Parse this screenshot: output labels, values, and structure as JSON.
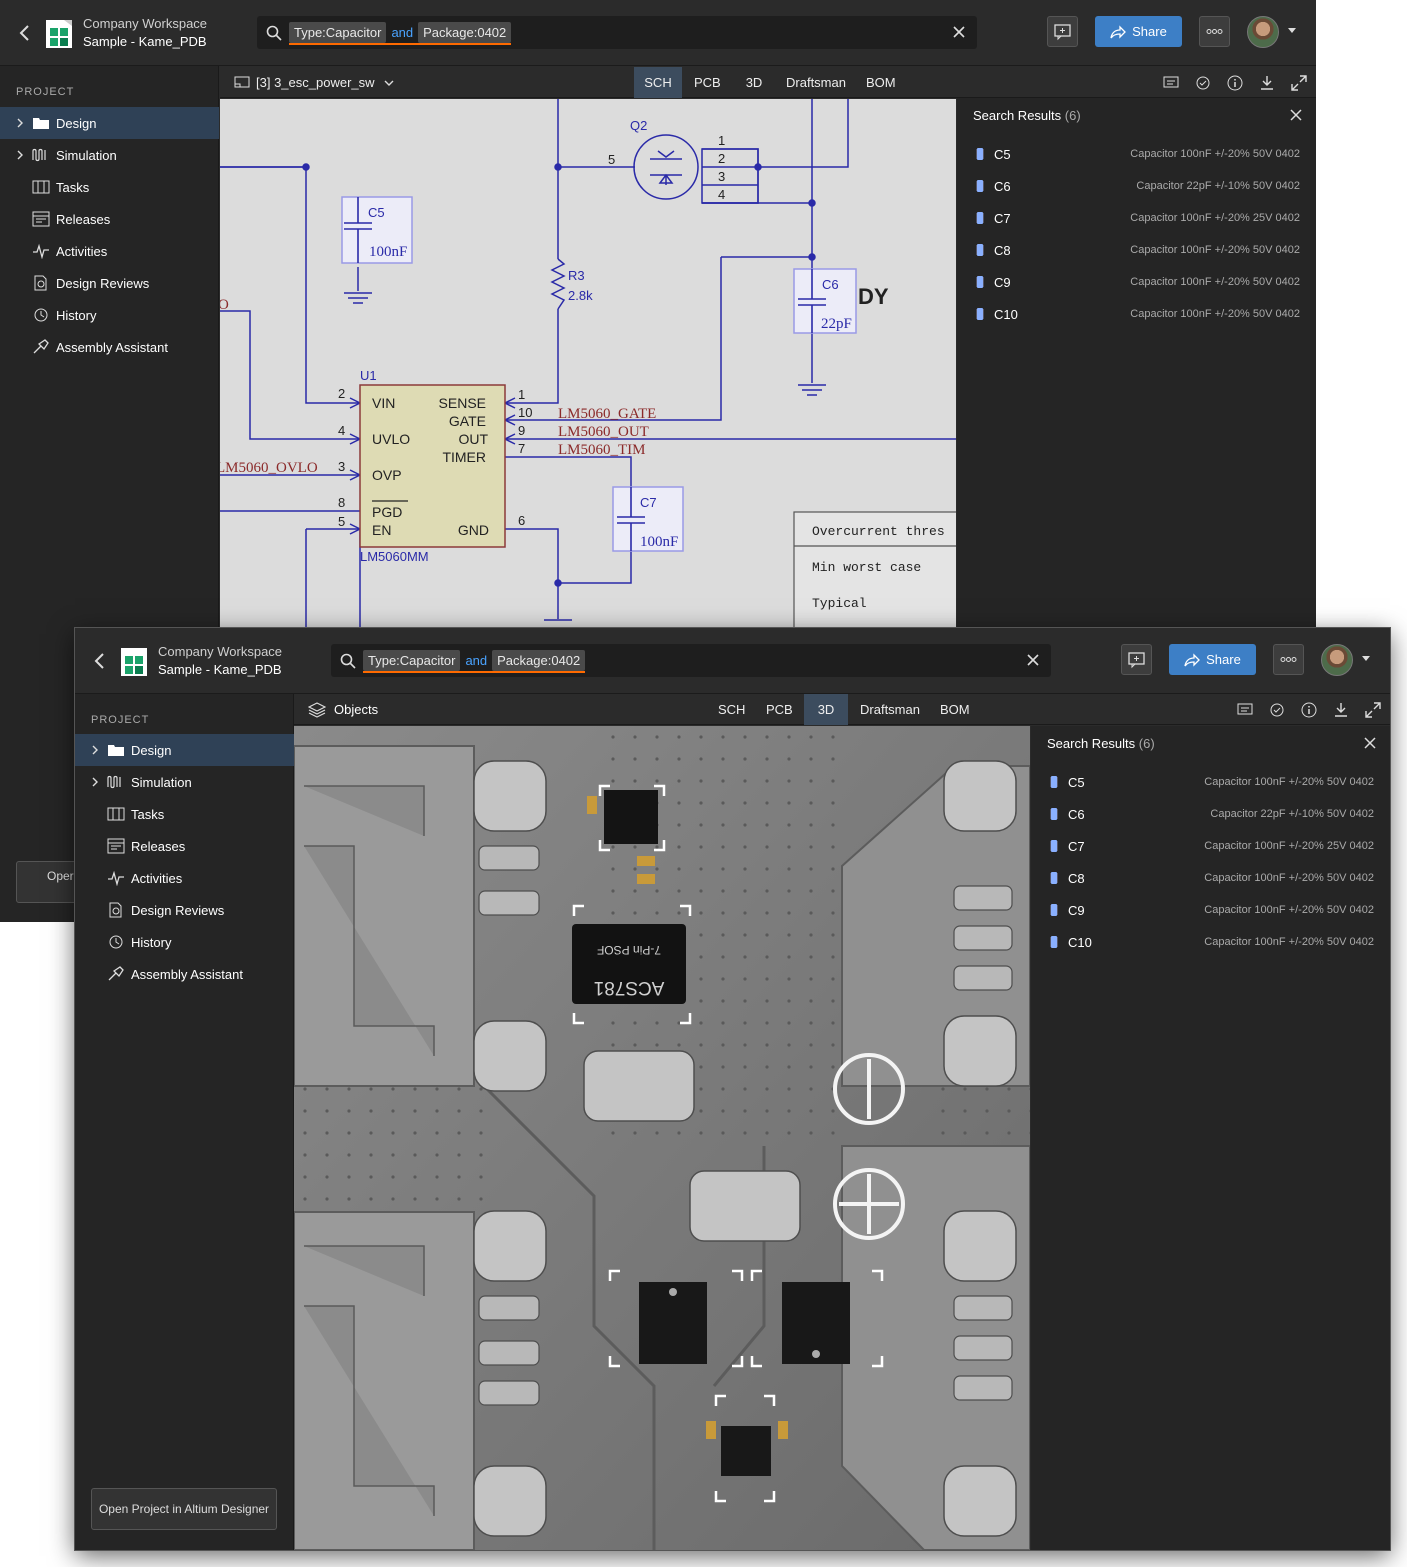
{
  "workspace": {
    "name": "Company Workspace",
    "project": "Sample - Kame_PDB"
  },
  "search": {
    "chip1": "Type:Capacitor",
    "joiner": "and",
    "chip2": "Package:0402"
  },
  "share_label": "Share",
  "sidebar": {
    "heading": "PROJECT",
    "items": [
      "Design",
      "Simulation",
      "Tasks",
      "Releases",
      "Activities",
      "Design Reviews",
      "History",
      "Assembly Assistant"
    ],
    "open_button": "Open Project in Altium Designer",
    "open_button_partial": "Oper"
  },
  "tabs": [
    "SCH",
    "PCB",
    "3D",
    "Draftsman",
    "BOM"
  ],
  "document": "[3] 3_esc_power_sw",
  "objects_label": "Objects",
  "results": {
    "title": "Search Results",
    "count": "(6)",
    "items": [
      {
        "designator": "C5",
        "description": "Capacitor 100nF +/-20% 50V 0402"
      },
      {
        "designator": "C6",
        "description": "Capacitor 22pF +/-10% 50V 0402"
      },
      {
        "designator": "C7",
        "description": "Capacitor 100nF +/-20% 25V 0402"
      },
      {
        "designator": "C8",
        "description": "Capacitor 100nF +/-20% 50V 0402"
      },
      {
        "designator": "C9",
        "description": "Capacitor 100nF +/-20% 50V 0402"
      },
      {
        "designator": "C10",
        "description": "Capacitor 100nF +/-20% 50V 0402"
      }
    ]
  },
  "schematic": {
    "q2": "Q2",
    "q2_pins": [
      "1",
      "2",
      "3",
      "4",
      "5"
    ],
    "c5": {
      "ref": "C5",
      "val": "100nF"
    },
    "c6": {
      "ref": "C6",
      "val": "22pF"
    },
    "c7": {
      "ref": "C7",
      "val": "100nF"
    },
    "r3": {
      "ref": "R3",
      "val": "2.8k"
    },
    "u1": {
      "ref": "U1",
      "part": "LM5060MM",
      "left_pins": [
        "VIN",
        "UVLO",
        "OVP",
        "PGD",
        "EN"
      ],
      "right_pins": [
        "SENSE",
        "GATE",
        "OUT",
        "TIMER",
        "GND"
      ],
      "left_nums": [
        "2",
        "4",
        "3",
        "8",
        "5"
      ],
      "right_nums": [
        "1",
        "10",
        "9",
        "7",
        "6"
      ]
    },
    "nets": [
      "LM5060_GATE",
      "LM5060_OUT",
      "LM5060_TIM",
      "LM5060_OVLO",
      "O"
    ],
    "dy": "DY",
    "notes": [
      "Overcurrent thres",
      "Min worst case",
      "Typical"
    ],
    "pin_labels": [
      "1",
      "2"
    ]
  },
  "pcb": {
    "ic_top": "7-Pin PSOF",
    "ic_bottom": "ACS781"
  }
}
